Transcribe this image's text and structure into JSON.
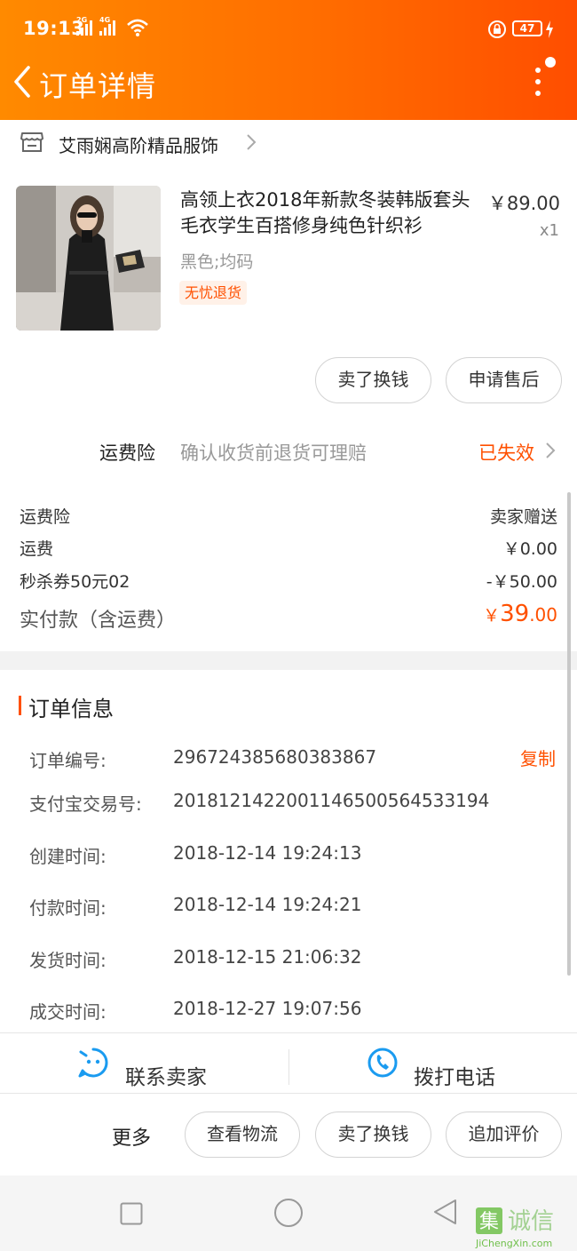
{
  "status_bar": {
    "time": "19:13",
    "sim1_tag": "2G",
    "sim2_tag": "4G",
    "battery": "47",
    "icons": [
      "signal-icon",
      "wifi-icon",
      "lock-icon",
      "battery-icon",
      "charging-icon"
    ]
  },
  "nav": {
    "title": "订单详情",
    "back_icon": "chevron-left-icon",
    "more_icon": "vertical-ellipsis-icon"
  },
  "shop": {
    "name": "艾雨娴高阶精品服饰",
    "icon": "store-icon"
  },
  "product": {
    "title": "高领上衣2018年新款冬装韩版套头毛衣学生百搭修身纯色针织衫",
    "price": "￥89.00",
    "quantity": "x1",
    "sku": "黑色;均码",
    "tag": "无忧退货",
    "actions": [
      "卖了换钱",
      "申请售后"
    ]
  },
  "shipping_insurance": {
    "label": "运费险",
    "description": "确认收货前退货可理赔",
    "status": "已失效"
  },
  "fees": [
    {
      "label": "运费险",
      "value": "卖家赠送"
    },
    {
      "label": "运费",
      "value": "￥0.00"
    },
    {
      "label": "秒杀券50元02",
      "value": "-￥50.00"
    }
  ],
  "total": {
    "label": "实付款（含运费）",
    "currency": "￥",
    "integer": "39",
    "decimal": ".00"
  },
  "order_info": {
    "title": "订单信息",
    "copy_label": "复制",
    "rows": [
      {
        "label": "订单编号:",
        "value": "296724385680383867"
      },
      {
        "label": "支付宝交易号:",
        "value": "2018121422001146500564533194"
      },
      {
        "label": "创建时间:",
        "value": "2018-12-14 19:24:13"
      },
      {
        "label": "付款时间:",
        "value": "2018-12-14 19:24:21"
      },
      {
        "label": "发货时间:",
        "value": "2018-12-15 21:06:32"
      },
      {
        "label": "成交时间:",
        "value": "2018-12-27 19:07:56"
      }
    ]
  },
  "contact": {
    "seller_label": "联系卖家",
    "phone_label": "拨打电话"
  },
  "footer": {
    "more_label": "更多",
    "buttons": [
      "查看物流",
      "卖了换钱",
      "追加评价"
    ]
  },
  "watermark": {
    "site": "JiChengXin.com",
    "logo_text": "集诚信"
  },
  "colors": {
    "brand_orange": "#ff5000",
    "header_gradient_start": "#ff8a00",
    "header_gradient_end": "#ff4e00",
    "accent_blue": "#1a9bf0"
  }
}
